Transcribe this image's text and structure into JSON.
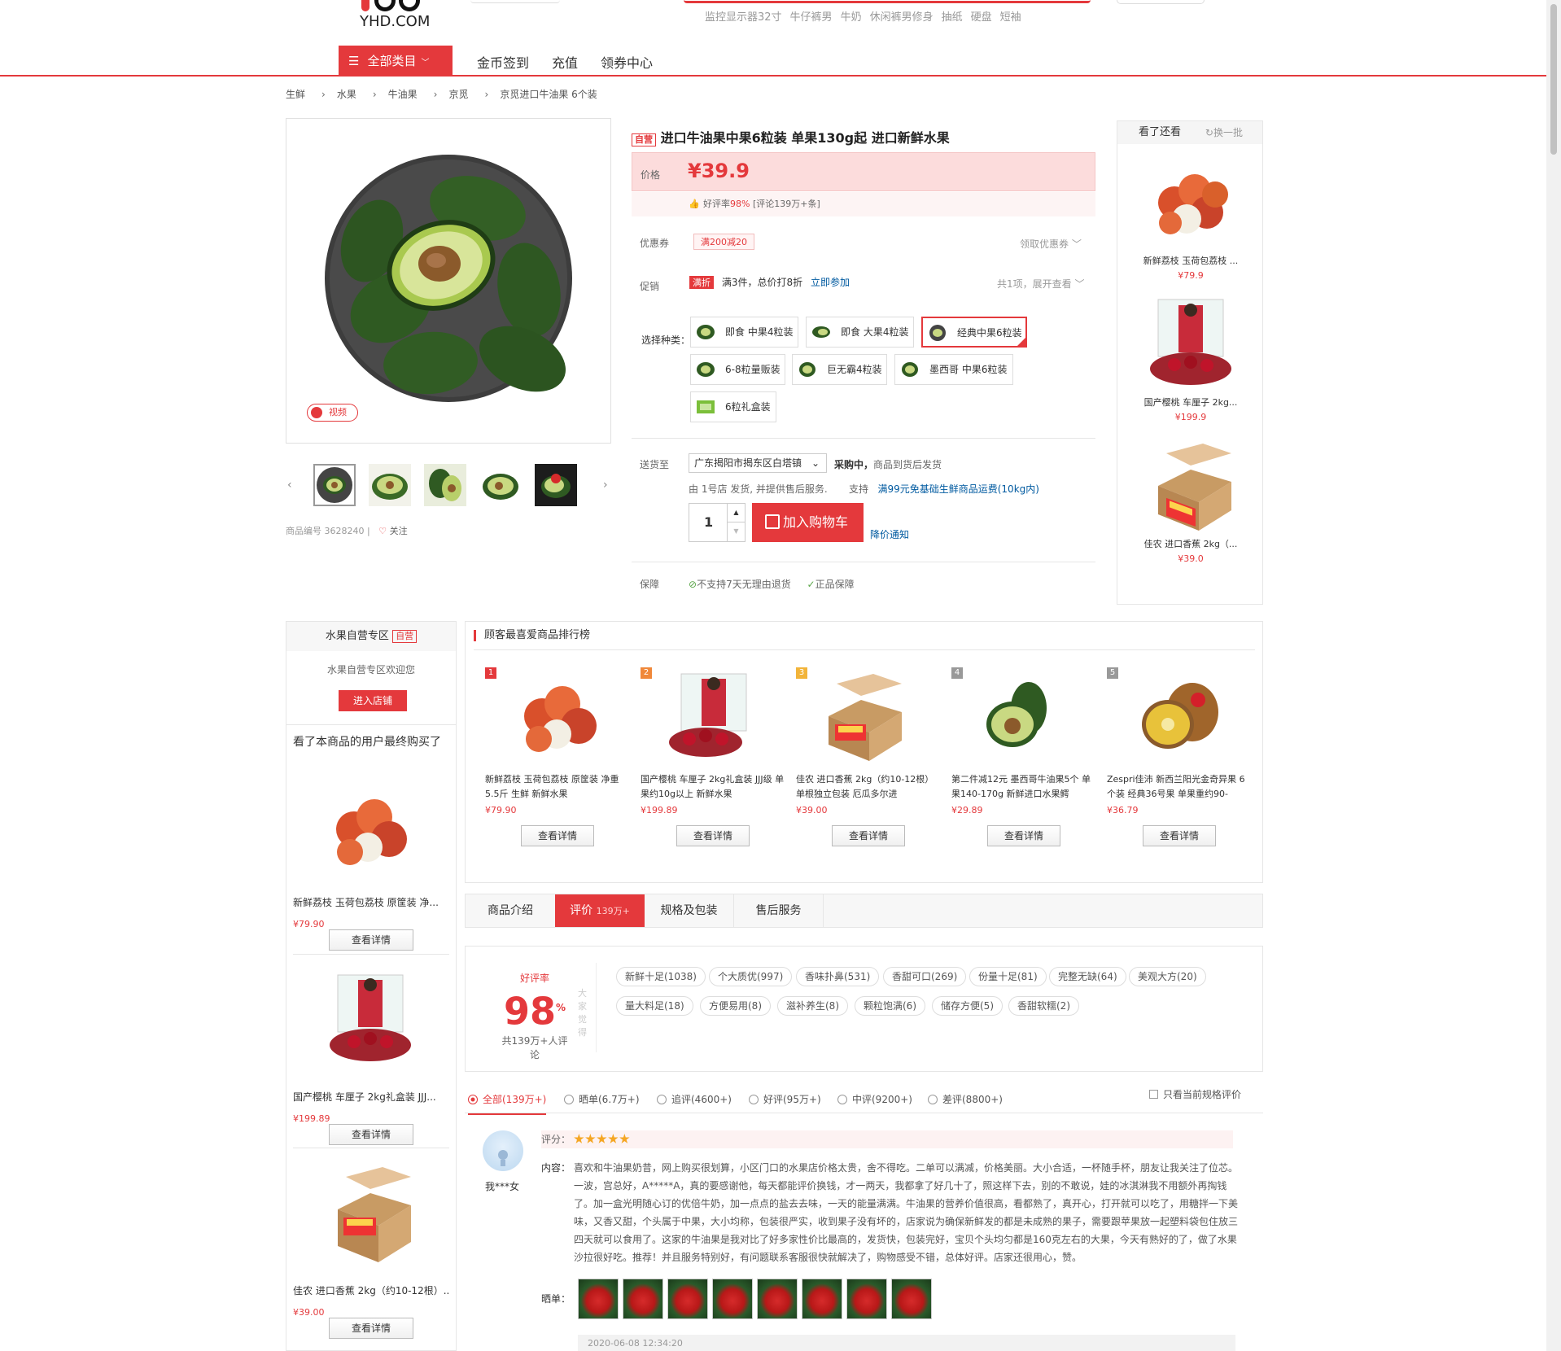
{
  "header": {
    "logo_text": "YHD.COM",
    "hot_searches": [
      "监控显示器32寸",
      "牛仔裤男",
      "牛奶",
      "休闲裤男修身",
      "抽纸",
      "硬盘",
      "短袖"
    ],
    "category_button": "全部类目",
    "nav_links": [
      "金币签到",
      "充值",
      "领券中心"
    ]
  },
  "breadcrumb": [
    "生鲜",
    "水果",
    "牛油果",
    "京觅",
    "京觅进口牛油果 6个装"
  ],
  "product": {
    "self_tag": "自营",
    "title": "进口牛油果中果6粒装 单果130g起 进口新鲜水果",
    "price_label": "价格",
    "price": "¥39.9",
    "rating_label": "好评率",
    "rating_value": "98%",
    "rating_count": "[评论139万+条]",
    "coupon_label": "优惠券",
    "coupon": "满200减20",
    "coupon_link": "领取优惠券",
    "promo_label": "促销",
    "promo_tag": "满折",
    "promo_text": "满3件，总价打8折",
    "promo_link": "立即参加",
    "promo_more": "共1项，展开查看",
    "select_label": "选择种类：",
    "options": [
      "即食 中果4粒装",
      "即食 大果4粒装",
      "经典中果6粒装",
      "6-8粒量贩装",
      "巨无霸4粒装",
      "墨西哥 中果6粒装",
      "6粒礼盒装"
    ],
    "ship_label": "送货至",
    "address": "广东揭阳市揭东区白塔镇",
    "stock": "采购中，",
    "stock_note": "商品到货后发货",
    "seller_note": "由  1号店  发货, 并提供售后服务.",
    "support_label": "支持",
    "support_link": "满99元免基础生鲜商品运费(10kg内)",
    "qty": "1",
    "cart_button": "加入购物车",
    "price_notice": "降价通知",
    "guarantee_label": "保障",
    "guarantee_1": "不支持7天无理由退货",
    "guarantee_2": "正品保障",
    "video_label": "视频",
    "sku_label": "商品编号",
    "sku": "3628240",
    "follow": "关注"
  },
  "see_also": {
    "title": "看了还看",
    "refresh": "换一批",
    "items": [
      {
        "name": "新鲜荔枝 玉荷包荔枝 ...",
        "price": "¥79.9"
      },
      {
        "name": "国产樱桃 车厘子 2kg...",
        "price": "¥199.9"
      },
      {
        "name": "佳农 进口香蕉 2kg（...",
        "price": "¥39.0"
      }
    ]
  },
  "store": {
    "title": "水果自营专区",
    "tag": "自营",
    "welcome": "水果自营专区欢迎您",
    "enter": "进入店铺",
    "bought_title": "看了本商品的用户最终购买了",
    "items": [
      {
        "name": "新鲜荔枝 玉荷包荔枝 原筐装 净...",
        "price": "¥79.90",
        "button": "查看详情"
      },
      {
        "name": "国产樱桃 车厘子 2kg礼盒装 JJJ...",
        "price": "¥199.89",
        "button": "查看详情"
      },
      {
        "name": "佳农 进口香蕉 2kg（约10-12根）...",
        "price": "¥39.00",
        "button": "查看详情"
      }
    ]
  },
  "ranking": {
    "title": "顾客最喜爱商品排行榜",
    "items": [
      {
        "rank": "1",
        "name": "新鲜荔枝 玉荷包荔枝 原筐装 净重5.5斤 生鲜 新鲜水果",
        "price": "¥79.90",
        "button": "查看详情"
      },
      {
        "rank": "2",
        "name": "国产樱桃 车厘子 2kg礼盒装 JJJ级 单果约10g以上 新鲜水果",
        "price": "¥199.89",
        "button": "查看详情"
      },
      {
        "rank": "3",
        "name": "佳农 进口香蕉 2kg（约10-12根） 单根独立包装 厄瓜多尔进",
        "price": "¥39.00",
        "button": "查看详情"
      },
      {
        "rank": "4",
        "name": "第二件减12元 墨西哥牛油果5个 单果140-170g 新鲜进口水果鳄",
        "price": "¥29.89",
        "button": "查看详情"
      },
      {
        "rank": "5",
        "name": "Zespri佳沛 新西兰阳光金奇异果 6个装 经典36号果 单果重约90-",
        "price": "¥36.79",
        "button": "查看详情"
      }
    ]
  },
  "tabs": [
    {
      "label": "商品介绍",
      "count": ""
    },
    {
      "label": "评价",
      "count": "139万+"
    },
    {
      "label": "规格及包装",
      "count": ""
    },
    {
      "label": "售后服务",
      "count": ""
    }
  ],
  "reviews": {
    "rate_label": "好评率",
    "rate": "98",
    "rate_unit": "%",
    "total": "共139万+人评论",
    "vertical": "大家觉得",
    "tags": [
      "新鲜十足(1038)",
      "个大质优(997)",
      "香味扑鼻(531)",
      "香甜可口(269)",
      "份量十足(81)",
      "完整无缺(64)",
      "美观大方(20)",
      "量大料足(18)",
      "方便易用(8)",
      "滋补养生(8)",
      "颗粒饱满(6)",
      "储存方便(5)",
      "香甜软糯(2)"
    ],
    "filters": [
      "全部(139万+)",
      "晒单(6.7万+)",
      "追评(4600+)",
      "好评(95万+)",
      "中评(9200+)",
      "差评(8800+)"
    ],
    "only_current": "只看当前规格评价",
    "first": {
      "user": "我***女",
      "score_label": "评分：",
      "stars": 5,
      "content_label": "内容：",
      "content": "喜欢和牛油果奶昔，网上购买很划算，小区门口的水果店价格太贵，舍不得吃。二单可以满减，价格美丽。大小合适，一杯随手杯，朋友让我关注了位芯。一波，宫总好，A*****A，真的要感谢他，每天都能评价换钱，才一两天，我都拿了好几十了，照这样下去，别的不敢说，娃的冰淇淋我不用额外再掏钱了。加一盒光明随心订的优倍牛奶，加一点点的盐去去味，一天的能量满满。牛油果的营养价值很高，看都熟了，真开心，打开就可以吃了，用糖拌一下美味，又香又甜，个头属于中果，大小均称，包装很严实，收到果子没有坏的，店家说为确保新鲜发的都是未成熟的果子，需要跟苹果放一起塑料袋包住放三四天就可以食用了。这家的牛油果是我对比了好多家性价比最高的，发货快，包装完好，宝贝个头均匀都是160克左右的大果，今天有熟好的了，做了水果沙拉很好吃。推荐！并且服务特别好，有问题联系客服很快就解决了，购物感受不错，总体好评。店家还很用心，赞。",
      "photos_label": "晒单：",
      "photo_count": 8,
      "date": "2020-06-08 12:34:20"
    }
  },
  "colors": {
    "accent": "#e4393c",
    "link": "#005aa0"
  }
}
